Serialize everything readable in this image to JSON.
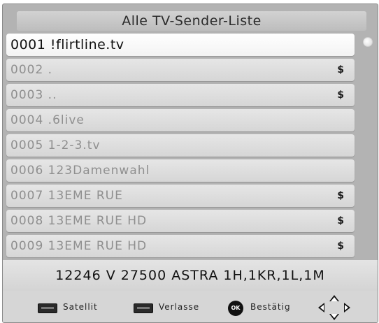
{
  "title": "Alle TV-Sender-Liste",
  "channels": [
    {
      "label": "0001 !flirtline.tv",
      "badge": ""
    },
    {
      "label": "0002 .",
      "badge": "$"
    },
    {
      "label": "0003 ..",
      "badge": "$"
    },
    {
      "label": "0004 .6live",
      "badge": ""
    },
    {
      "label": "0005 1-2-3.tv",
      "badge": ""
    },
    {
      "label": "0006 123Damenwahl",
      "badge": ""
    },
    {
      "label": "0007 13EME RUE",
      "badge": "$"
    },
    {
      "label": "0008 13EME RUE HD",
      "badge": "$"
    },
    {
      "label": "0009 13EME RUE HD",
      "badge": "$"
    }
  ],
  "selected_index": 0,
  "info": "12246 V 27500  ASTRA 1H,1KR,1L,1M",
  "help": {
    "satellite": "Satellit",
    "exit": "Verlasse",
    "ok_key": "OK",
    "confirm": "Bestätig"
  },
  "colors": {
    "background": "#b3b3b3",
    "row": "#dcdcdc",
    "row_selected": "#ffffff",
    "inactive_text": "#8f8f8f"
  },
  "icons": {
    "scroll_indicator": "scroll-dot-icon",
    "satellite_key": "satellite-key-icon",
    "exit_key": "exit-key-icon",
    "ok_key": "ok-button-icon",
    "navigation": "navigation-arrows-icon"
  }
}
